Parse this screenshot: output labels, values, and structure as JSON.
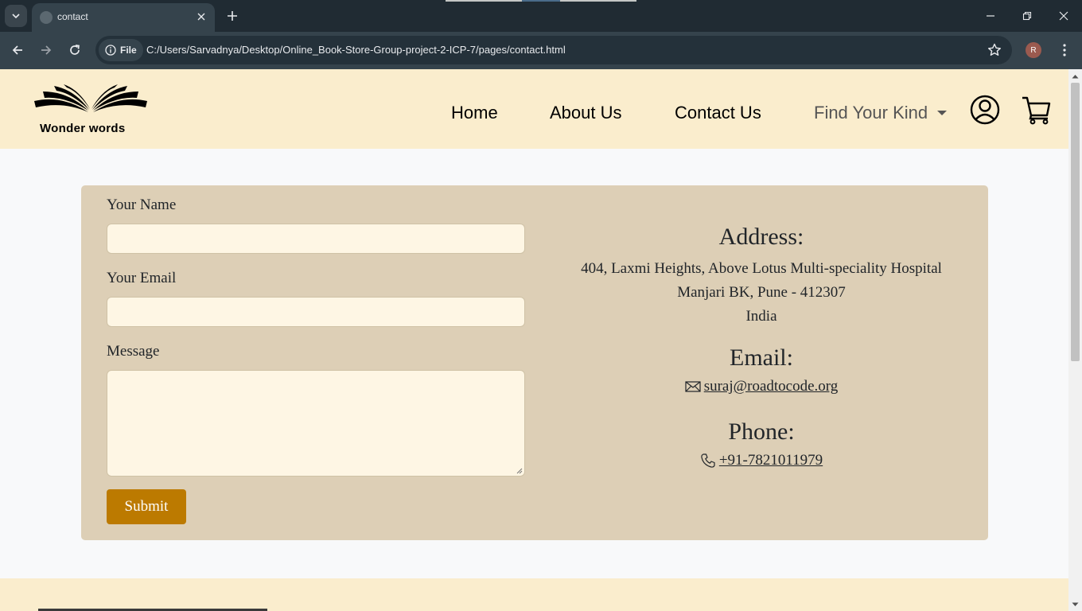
{
  "browser": {
    "tab_title": "contact",
    "file_chip": "File",
    "url": "C:/Users/Sarvadnya/Desktop/Online_Book-Store-Group-project-2-ICP-7/pages/contact.html",
    "profile_initial": "R"
  },
  "header": {
    "logo_text": "Wonder words",
    "nav": {
      "home": "Home",
      "about": "About Us",
      "contact": "Contact Us",
      "find": "Find Your Kind"
    }
  },
  "form": {
    "name_label": "Your Name",
    "name_value": "",
    "email_label": "Your Email",
    "email_value": "",
    "message_label": "Message",
    "message_value": "",
    "submit_label": "Submit"
  },
  "info": {
    "address_heading": "Address:",
    "address_line1": "404, Laxmi Heights, Above Lotus Multi-speciality Hospital",
    "address_line2": "Manjari BK, Pune - 412307",
    "address_line3": "India",
    "email_heading": "Email:",
    "email_value": " suraj@roadtocode.org",
    "phone_heading": "Phone:",
    "phone_value": " +91-7821011979"
  },
  "colors": {
    "header_bg": "#faedcd",
    "card_bg": "#ddcfb6",
    "input_bg": "#fef6e4",
    "submit_bg": "#bc7a00"
  }
}
